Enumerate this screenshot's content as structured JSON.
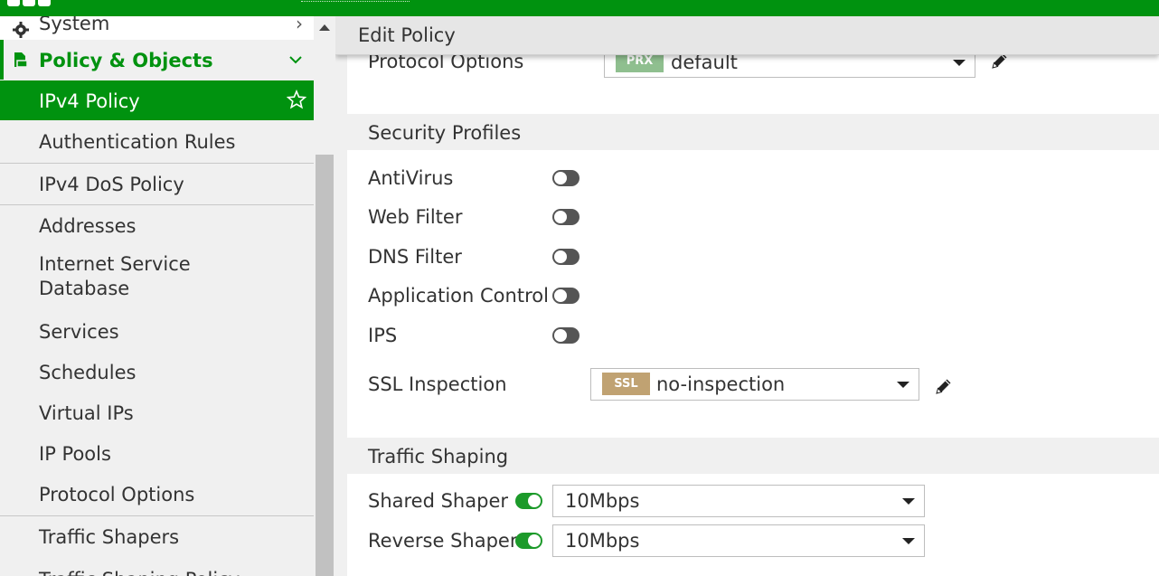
{
  "colors": {
    "brand_green": "#00920f",
    "prx_badge": "#8fbf8f",
    "ssl_badge": "#c0a272"
  },
  "sidebar": {
    "system_label": "System",
    "policy_group_label": "Policy & Objects",
    "items": [
      {
        "label": "IPv4 Policy",
        "active": true
      },
      {
        "label": "Authentication Rules"
      },
      {
        "label": "IPv4 DoS Policy"
      },
      {
        "label": "Addresses"
      },
      {
        "label": "Internet Service"
      },
      {
        "label": "Database"
      },
      {
        "label": "Services"
      },
      {
        "label": "Schedules"
      },
      {
        "label": "Virtual IPs"
      },
      {
        "label": "IP Pools"
      },
      {
        "label": "Protocol Options"
      },
      {
        "label": "Traffic Shapers"
      },
      {
        "label": "Traffic Shaping Policy"
      }
    ]
  },
  "header": {
    "title": "Edit Policy"
  },
  "protocol_options": {
    "label": "Protocol Options",
    "badge": "PRX",
    "value": "default"
  },
  "security_profiles": {
    "title": "Security Profiles",
    "items": [
      {
        "label": "AntiVirus",
        "enabled": false
      },
      {
        "label": "Web Filter",
        "enabled": false
      },
      {
        "label": "DNS Filter",
        "enabled": false
      },
      {
        "label": "Application Control",
        "enabled": false
      },
      {
        "label": "IPS",
        "enabled": false
      }
    ],
    "ssl": {
      "label": "SSL Inspection",
      "badge": "SSL",
      "value": "no-inspection"
    }
  },
  "traffic_shaping": {
    "title": "Traffic Shaping",
    "shared": {
      "label": "Shared Shaper",
      "enabled": true,
      "value": "10Mbps"
    },
    "reverse": {
      "label": "Reverse Shaper",
      "enabled": true,
      "value": "10Mbps"
    }
  }
}
